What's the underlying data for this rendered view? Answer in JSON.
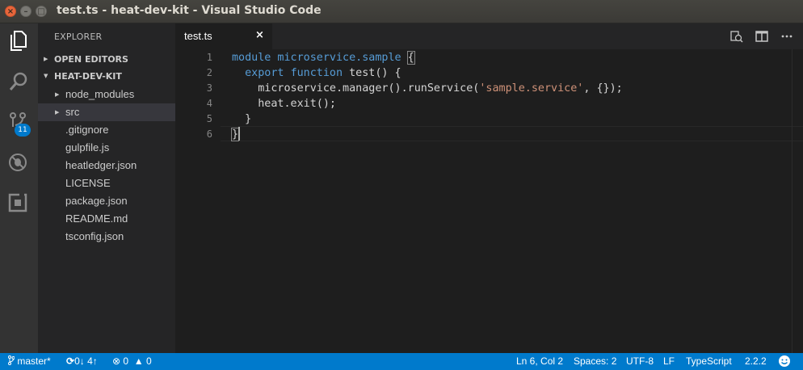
{
  "window": {
    "title": "test.ts - heat-dev-kit - Visual Studio Code"
  },
  "activity_bar": {
    "items": [
      "explorer-icon",
      "search-icon",
      "source-control-icon",
      "debug-icon",
      "extensions-icon"
    ],
    "scm_badge": "11"
  },
  "sidebar": {
    "title": "EXPLORER",
    "open_editors": "OPEN EDITORS",
    "project": "HEAT-DEV-KIT",
    "items": [
      {
        "label": "node_modules",
        "folder": true
      },
      {
        "label": "src",
        "folder": true
      },
      {
        "label": ".gitignore"
      },
      {
        "label": "gulpfile.js"
      },
      {
        "label": "heatledger.json"
      },
      {
        "label": "LICENSE"
      },
      {
        "label": "package.json"
      },
      {
        "label": "README.md"
      },
      {
        "label": "tsconfig.json"
      }
    ]
  },
  "tabs": [
    {
      "label": "test.ts",
      "close": "×"
    }
  ],
  "editor": {
    "line_numbers": [
      "1",
      "2",
      "3",
      "4",
      "5",
      "6"
    ],
    "code": {
      "l1_a": "module microservice.sample ",
      "l1_b": "{",
      "l2_kw1": "export",
      "l2_kw2": "function",
      "l2_rest": " test() {",
      "l3_a": "microservice.manager().runService(",
      "l3_str": "'sample.service'",
      "l3_b": ", {});",
      "l4": "heat.exit();",
      "l5": "}",
      "l6": "}"
    }
  },
  "status_bar": {
    "branch": "master*",
    "sync": "0↓ 4↑",
    "errors": "0",
    "warnings": "0",
    "position": "Ln 6, Col 2",
    "spaces": "Spaces: 2",
    "encoding": "UTF-8",
    "eol": "LF",
    "language": "TypeScript",
    "version": "2.2.2"
  },
  "colors": {
    "accent": "#007acc",
    "keyword": "#569cd6",
    "string": "#ce9178"
  }
}
